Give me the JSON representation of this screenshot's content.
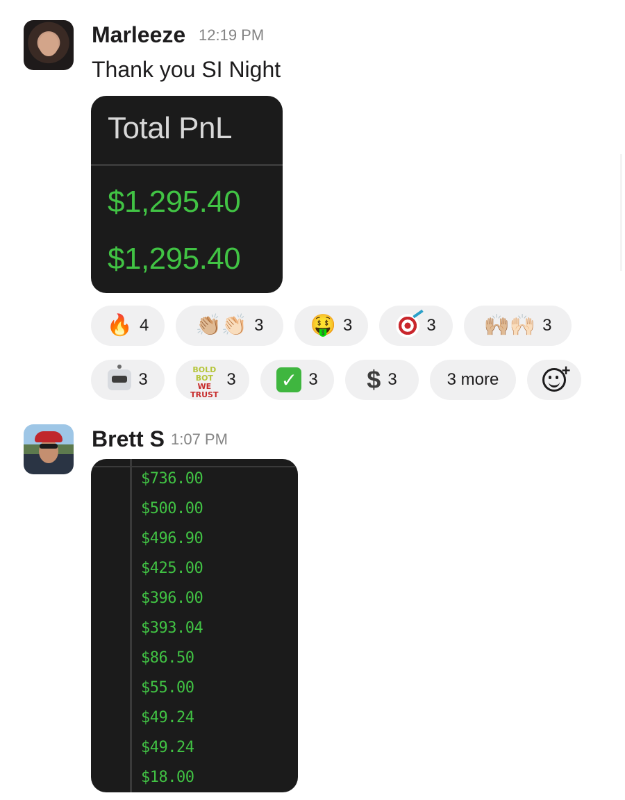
{
  "messages": [
    {
      "author": "Marleeze",
      "time": "12:19 PM",
      "text": "Thank you SI Night",
      "attachment": {
        "title": "Total PnL",
        "values": [
          "$1,295.40",
          "$1,295.40"
        ]
      },
      "reactions_row1": [
        {
          "icon": "fire-emoji",
          "glyph": "🔥",
          "count": "4"
        },
        {
          "icon": "clapping-hands-emoji",
          "glyph": "👏🏼👏🏻",
          "count": "3"
        },
        {
          "icon": "money-mouth-face-emoji",
          "glyph": "🤑",
          "count": "3"
        },
        {
          "icon": "direct-hit-emoji",
          "glyph": "",
          "count": "3"
        },
        {
          "icon": "raising-hands-emoji",
          "glyph": "🙌🏼🙌🏻",
          "count": "3"
        }
      ],
      "reactions_row2": [
        {
          "icon": "robot-emoji",
          "count": "3"
        },
        {
          "icon": "in-bot-we-trust-emoji",
          "line1": "BOLD BOT",
          "line2": "WE TRUST",
          "count": "3"
        },
        {
          "icon": "check-mark-button-emoji",
          "glyph": "✓",
          "count": "3"
        },
        {
          "icon": "heavy-dollar-sign-emoji",
          "glyph": "$",
          "count": "3"
        },
        {
          "label": "3 more"
        }
      ],
      "add_reaction": "add-reaction-icon"
    },
    {
      "author": "Brett S",
      "time": "1:07 PM",
      "attachment": {
        "values": [
          "$736.00",
          "$500.00",
          "$496.90",
          "$425.00",
          "$396.00",
          "$393.04",
          "$86.50",
          "$55.00",
          "$49.24",
          "$49.24",
          "$18.00"
        ]
      }
    }
  ],
  "colors": {
    "name": "#1d1c1d",
    "timestamp": "#838383",
    "reaction_bg": "#f0f0f1",
    "card_bg": "#1b1b1b",
    "profit_green": "#41c344"
  }
}
